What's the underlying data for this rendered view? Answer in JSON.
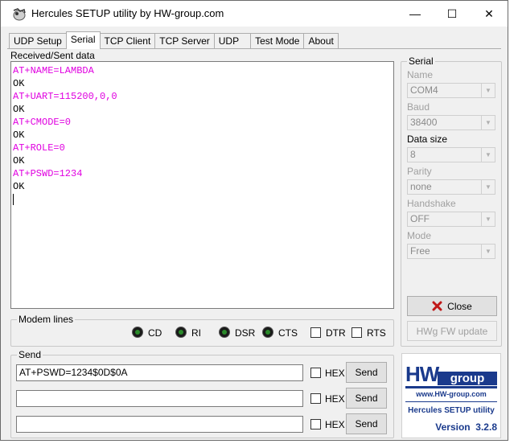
{
  "window": {
    "title": "Hercules SETUP utility by HW-group.com"
  },
  "titlebar_buttons": {
    "minimize": "—",
    "maximize": "☐",
    "close": "✕"
  },
  "tabs": [
    {
      "label": "UDP Setup"
    },
    {
      "label": "Serial"
    },
    {
      "label": "TCP Client"
    },
    {
      "label": "TCP Server"
    },
    {
      "label": "UDP"
    },
    {
      "label": "Test Mode"
    },
    {
      "label": "About"
    }
  ],
  "received": {
    "label": "Received/Sent data",
    "lines": [
      {
        "text": "AT+NAME=LAMBDA",
        "kind": "sent"
      },
      {
        "text": "OK",
        "kind": "recv"
      },
      {
        "text": "AT+UART=115200,0,0",
        "kind": "sent"
      },
      {
        "text": "OK",
        "kind": "recv"
      },
      {
        "text": "AT+CMODE=0",
        "kind": "sent"
      },
      {
        "text": "OK",
        "kind": "recv"
      },
      {
        "text": "AT+ROLE=0",
        "kind": "sent"
      },
      {
        "text": "OK",
        "kind": "recv"
      },
      {
        "text": "AT+PSWD=1234",
        "kind": "sent"
      },
      {
        "text": "OK",
        "kind": "recv"
      }
    ]
  },
  "serial": {
    "legend": "Serial",
    "name_label": "Name",
    "name_value": "COM4",
    "baud_label": "Baud",
    "baud_value": "38400",
    "datasize_label": "Data size",
    "datasize_value": "8",
    "parity_label": "Parity",
    "parity_value": "none",
    "handshake_label": "Handshake",
    "handshake_value": "OFF",
    "mode_label": "Mode",
    "mode_value": "Free",
    "close_label": "Close",
    "fw_label": "HWg FW update"
  },
  "modem": {
    "legend": "Modem lines",
    "cd": "CD",
    "ri": "RI",
    "dsr": "DSR",
    "cts": "CTS",
    "dtr": "DTR",
    "rts": "RTS"
  },
  "send": {
    "legend": "Send",
    "rows": [
      {
        "value": "AT+PSWD=1234$0D$0A",
        "hex": "HEX",
        "button": "Send"
      },
      {
        "value": "",
        "hex": "HEX",
        "button": "Send"
      },
      {
        "value": "",
        "hex": "HEX",
        "button": "Send"
      }
    ]
  },
  "logo": {
    "hw": "HW",
    "group": "group",
    "url": "www.HW-group.com",
    "product": "Hercules SETUP utility",
    "version": "Version  3.2.8"
  },
  "colors": {
    "sent_text": "#e000e0",
    "logo_blue": "#1a3a8c",
    "close_x": "#c01818"
  }
}
